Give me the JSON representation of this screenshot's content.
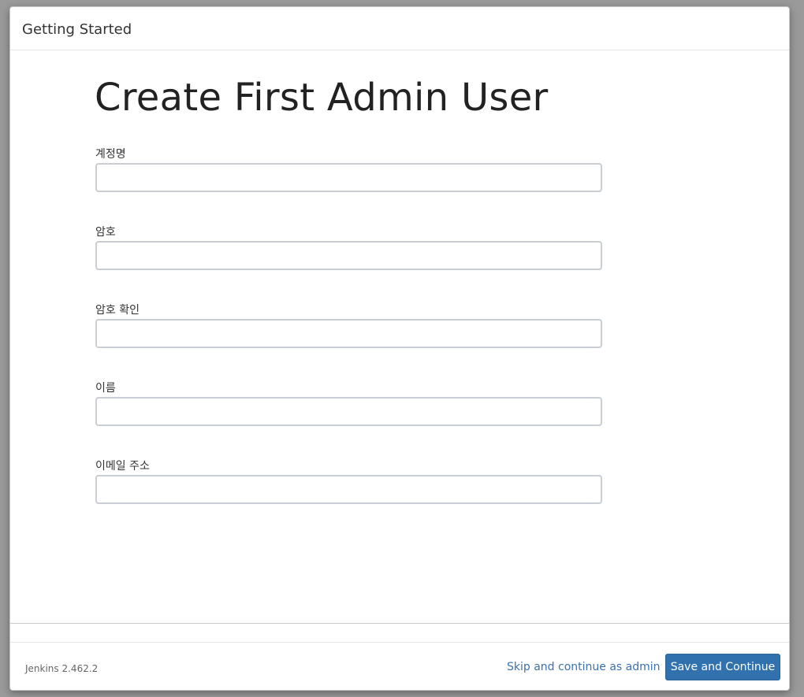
{
  "dialog": {
    "title": "Getting Started"
  },
  "form": {
    "heading": "Create First Admin User",
    "fields": [
      {
        "label": "계정명",
        "value": "",
        "type": "text"
      },
      {
        "label": "암호",
        "value": "",
        "type": "password"
      },
      {
        "label": "암호 확인",
        "value": "",
        "type": "password"
      },
      {
        "label": "이름",
        "value": "",
        "type": "text"
      },
      {
        "label": "이메일 주소",
        "value": "",
        "type": "email"
      }
    ]
  },
  "footer": {
    "version": "Jenkins 2.462.2",
    "skip_label": "Skip and continue as admin",
    "save_label": "Save and Continue"
  },
  "colors": {
    "primary_button": "#3071ae",
    "link": "#3a72b0"
  }
}
